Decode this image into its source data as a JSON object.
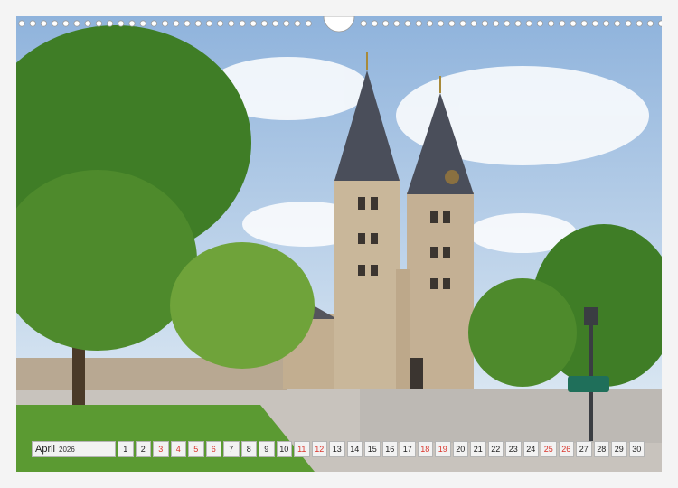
{
  "calendar": {
    "month": "April",
    "year": "2026",
    "weekend_color": "#d9342b",
    "days": [
      {
        "n": "1",
        "weekend": false
      },
      {
        "n": "2",
        "weekend": false
      },
      {
        "n": "3",
        "weekend": true
      },
      {
        "n": "4",
        "weekend": true
      },
      {
        "n": "5",
        "weekend": true
      },
      {
        "n": "6",
        "weekend": true
      },
      {
        "n": "7",
        "weekend": false
      },
      {
        "n": "8",
        "weekend": false
      },
      {
        "n": "9",
        "weekend": false
      },
      {
        "n": "10",
        "weekend": false
      },
      {
        "n": "11",
        "weekend": true
      },
      {
        "n": "12",
        "weekend": true
      },
      {
        "n": "13",
        "weekend": false
      },
      {
        "n": "14",
        "weekend": false
      },
      {
        "n": "15",
        "weekend": false
      },
      {
        "n": "16",
        "weekend": false
      },
      {
        "n": "17",
        "weekend": false
      },
      {
        "n": "18",
        "weekend": true
      },
      {
        "n": "19",
        "weekend": true
      },
      {
        "n": "20",
        "weekend": false
      },
      {
        "n": "21",
        "weekend": false
      },
      {
        "n": "22",
        "weekend": false
      },
      {
        "n": "23",
        "weekend": false
      },
      {
        "n": "24",
        "weekend": false
      },
      {
        "n": "25",
        "weekend": true
      },
      {
        "n": "26",
        "weekend": true
      },
      {
        "n": "27",
        "weekend": false
      },
      {
        "n": "28",
        "weekend": false
      },
      {
        "n": "29",
        "weekend": false
      },
      {
        "n": "30",
        "weekend": false
      }
    ]
  },
  "photo": {
    "sky_color": "#a9c6e6",
    "foliage_color": "#4e8a2c",
    "stone_color": "#c9b79a"
  }
}
